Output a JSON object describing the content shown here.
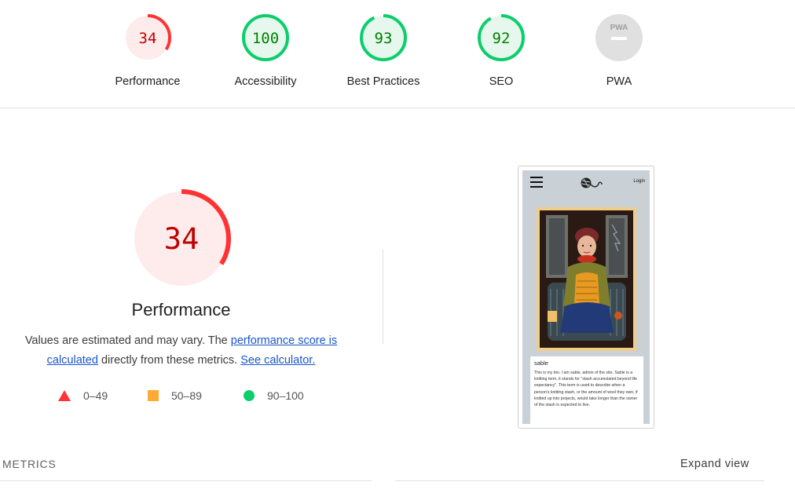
{
  "categories": [
    {
      "id": "performance",
      "score": "34",
      "score_value": 34,
      "label": "Performance",
      "rating": "fail"
    },
    {
      "id": "accessibility",
      "score": "100",
      "score_value": 100,
      "label": "Accessibility",
      "rating": "pass"
    },
    {
      "id": "best-practices",
      "score": "93",
      "score_value": 93,
      "label": "Best Practices",
      "rating": "pass"
    },
    {
      "id": "seo",
      "score": "92",
      "score_value": 92,
      "label": "SEO",
      "rating": "pass"
    },
    {
      "id": "pwa",
      "score": "PWA",
      "score_value": null,
      "label": "PWA",
      "rating": "na"
    }
  ],
  "colors": {
    "fail": "#ff3333",
    "fail_bg": "#fdeceb",
    "fail_text": "#c00000",
    "average": "#ffaa33",
    "pass": "#0cce6b",
    "pass_bg": "#e6f8ee",
    "pass_text": "#008000",
    "na": "#e0e0e0",
    "na_text": "#9e9e9e",
    "link": "#1a56c9"
  },
  "main": {
    "score": "34",
    "score_value": 34,
    "title": "Performance",
    "desc_prefix": "Values are estimated and may vary. The ",
    "desc_link1": "performance score is calculated",
    "desc_middle": " directly from these metrics. ",
    "desc_link2": "See calculator."
  },
  "legend": [
    {
      "shape": "triangle",
      "range": "0–49"
    },
    {
      "shape": "square",
      "range": "50–89"
    },
    {
      "shape": "circle",
      "range": "90–100"
    }
  ],
  "screenshot": {
    "login": "Login",
    "profile_name": "sable",
    "bio": "This is my bio. I am sable, admin of the site. Sable is a knitting term, it stands for \"stash accumulated beyond life expectancy\". This term is used to describe when a person's knitting stash, or the amount of wool they own, if knitted up into projects, would take longer than the owner of the stash is expected to live."
  },
  "metrics": {
    "title": "METRICS",
    "expand": "Expand view"
  }
}
